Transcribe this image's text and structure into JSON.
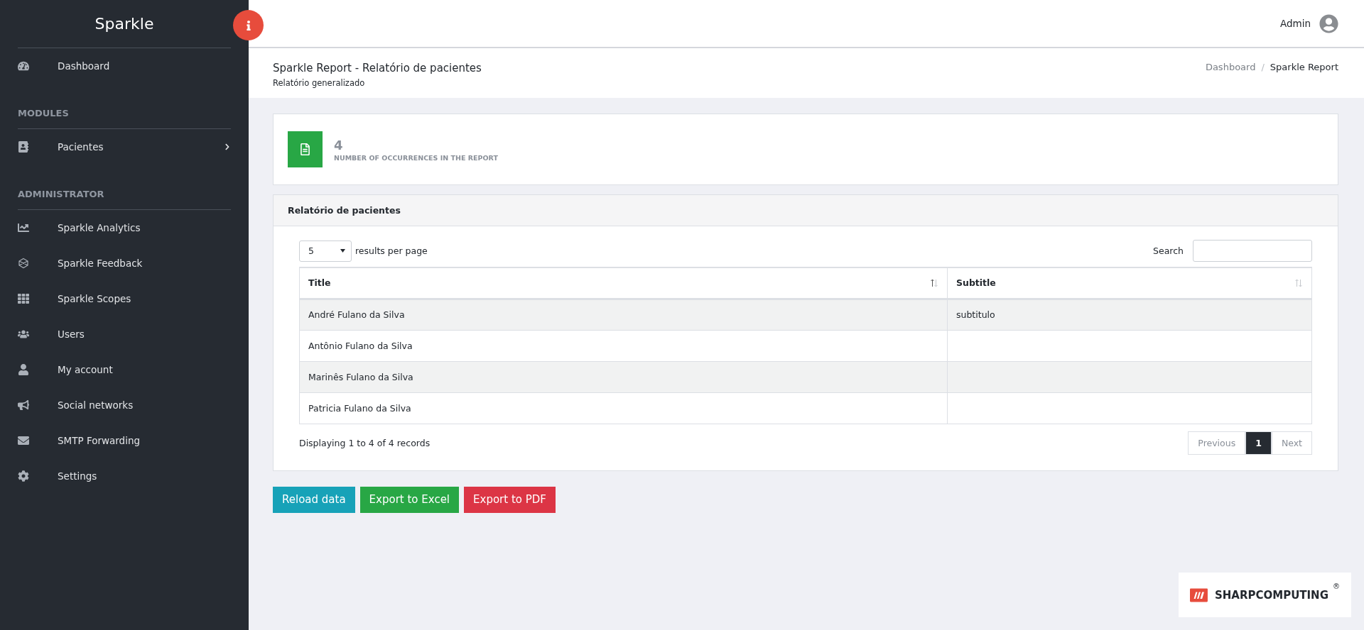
{
  "sidebar": {
    "brand": "Sparkle",
    "sections": [
      {
        "items": [
          {
            "label": "Dashboard"
          }
        ]
      },
      {
        "title": "MODULES",
        "items": [
          {
            "label": "Pacientes",
            "expanded": false
          }
        ]
      },
      {
        "title": "ADMINISTRATOR",
        "items": [
          {
            "label": "Sparkle Analytics"
          },
          {
            "label": "Sparkle Feedback"
          },
          {
            "label": "Sparkle Scopes"
          },
          {
            "label": "Users"
          },
          {
            "label": "My account"
          },
          {
            "label": "Social networks"
          },
          {
            "label": "SMTP Forwarding"
          },
          {
            "label": "Settings"
          }
        ]
      }
    ]
  },
  "topbar": {
    "user": "Admin"
  },
  "page_header": {
    "title": "Sparkle Report - Relatório de pacientes",
    "subtitle": "Relatório generalizado",
    "breadcrumb_separator": "/",
    "breadcrumb": [
      {
        "label": "Dashboard",
        "current": false
      },
      {
        "label": "Sparkle Report",
        "current": true
      }
    ]
  },
  "stat": {
    "value": "4",
    "label": "NUMBER OF OCCURRENCES IN THE REPORT"
  },
  "report": {
    "title": "Relatório de pacientes",
    "page_size": "5",
    "page_size_label": "results per page",
    "search_label": "Search",
    "table": {
      "columns": [
        {
          "label": "Title",
          "sorted": true
        },
        {
          "label": "Subtitle",
          "sorted": false
        }
      ],
      "rows": [
        [
          "André Fulano da Silva",
          "subtitulo"
        ],
        [
          "Antônio Fulano da Silva",
          null
        ],
        [
          "Marinês Fulano da Silva",
          null
        ],
        [
          "Patricia Fulano da Silva",
          null
        ]
      ]
    },
    "summary": "Displaying 1 to 4 of 4 records",
    "pagination": {
      "previous": {
        "label": "Previous",
        "disabled": true
      },
      "pages": [
        {
          "label": "1",
          "selected": true
        }
      ],
      "next": {
        "label": "Next",
        "disabled": true
      }
    }
  },
  "actions": [
    {
      "label": "Reload data",
      "kind": "info"
    },
    {
      "label": "Export to Excel",
      "kind": "success"
    },
    {
      "label": "Export to PDF",
      "kind": "danger"
    }
  ],
  "footer_logo": {
    "name": "SHARPCOMPUTING",
    "mark": "®"
  }
}
